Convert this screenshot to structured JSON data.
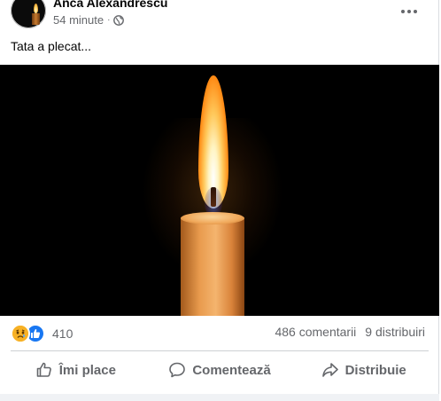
{
  "post": {
    "author": "Anca Alexandrescu",
    "time": "54 minute",
    "separator": "·",
    "privacy_icon": "globe-icon",
    "text": "Tata a plecat...",
    "image_subject": "lit candle on black background"
  },
  "stats": {
    "reaction_icons": [
      "sad-icon",
      "like-icon"
    ],
    "reaction_count": "410",
    "comments": "486 comentarii",
    "shares": "9 distribuiri"
  },
  "actions": {
    "like": "Îmi place",
    "comment": "Comentează",
    "share": "Distribuie"
  },
  "colors": {
    "secondary_text": "#65676b",
    "like_blue": "#1877f2",
    "sad_yellow": "#f7b125"
  }
}
